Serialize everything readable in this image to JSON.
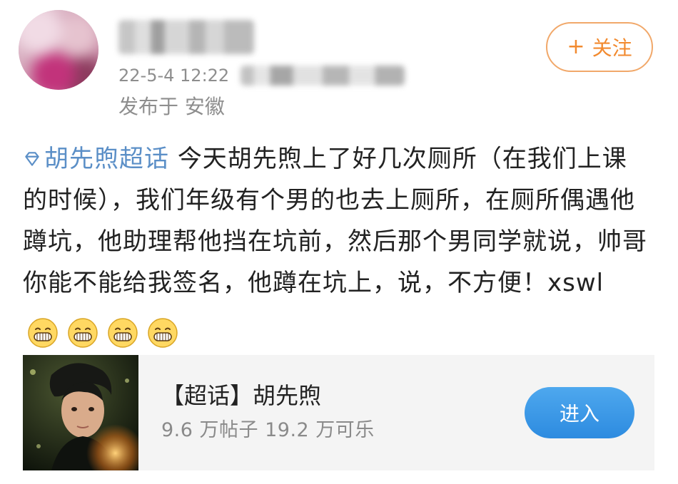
{
  "post": {
    "timestamp": "22-5-4 12:22",
    "location": "发布于 安徽",
    "follow_label": "关注",
    "follow_symbol": "+",
    "topic_link": "胡先煦超话",
    "content_text": " 今天胡先煦上了好几次厕所（在我们上课的时候），我们年级有个男的也去上厕所，在厕所偶遇他蹲坑，他助理帮他挡在坑前，然后那个男同学就说，帅哥你能不能给我签名，他蹲在坑上，说，不方便！xswl",
    "emojis": [
      "grinning-emoji",
      "grinning-emoji",
      "grinning-emoji",
      "grinning-emoji"
    ]
  },
  "super_topic_card": {
    "title": "【超话】胡先煦",
    "stats": "9.6 万帖子 19.2 万可乐",
    "enter_label": "进入"
  },
  "colors": {
    "accent_orange": "#f28a2f",
    "link_blue": "#5b8fc7",
    "button_blue": "#2d8be0"
  }
}
